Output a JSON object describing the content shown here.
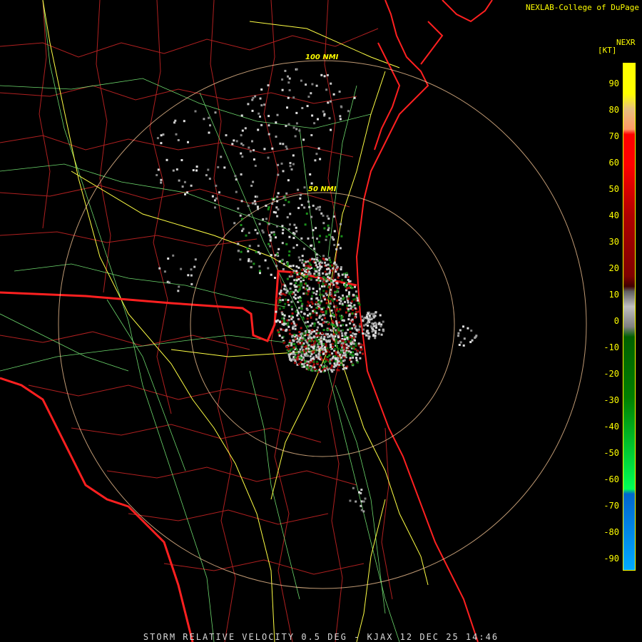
{
  "credit": "NEXLAB-College of DuPage",
  "legend": {
    "title": "NEXR",
    "units": "[KT]",
    "ticks": [
      "90",
      "80",
      "70",
      "60",
      "50",
      "40",
      "30",
      "20",
      "10",
      "0",
      "-10",
      "-20",
      "-30",
      "-40",
      "-50",
      "-60",
      "-70",
      "-80",
      "-90"
    ],
    "colors": {
      "top": "#ffff00",
      "orange": "#ff9966",
      "red": "#ff0000",
      "darkred": "#7f0000",
      "gray": "#c0c0c0",
      "darkgreen": "#006000",
      "green": "#00ff55",
      "blue": "#0066cc",
      "cyan": "#00aaff"
    }
  },
  "range_rings": [
    "50 NMI",
    "100 NMI"
  ],
  "footer": "STORM RELATIVE VELOCITY 0.5 DEG - KJAX 12 DEC 25 14:46",
  "map_colors": {
    "state_border": "#ff2020",
    "county_lines": "#b02020",
    "highways": "#ffff44",
    "roads": "#80ff80",
    "rings": "#ffcc99"
  }
}
